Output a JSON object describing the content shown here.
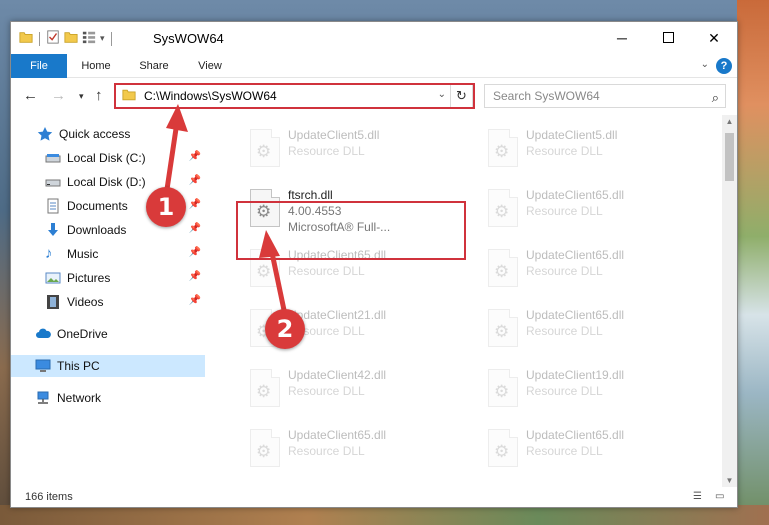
{
  "window": {
    "title": "SysWOW64"
  },
  "ribbon": {
    "tabs": [
      "File",
      "Home",
      "Share",
      "View"
    ],
    "help_label": "?"
  },
  "address": {
    "path": "C:\\Windows\\SysWOW64"
  },
  "search": {
    "placeholder": "Search SysWOW64"
  },
  "sidebar": {
    "items": [
      {
        "label": "Quick access",
        "icon": "star-icon"
      },
      {
        "label": "Local Disk (C:)",
        "icon": "drive-icon",
        "pinned": true
      },
      {
        "label": "Local Disk (D:)",
        "icon": "drive-icon",
        "pinned": true
      },
      {
        "label": "Documents",
        "icon": "document-icon",
        "pinned": true
      },
      {
        "label": "Downloads",
        "icon": "download-icon",
        "pinned": true
      },
      {
        "label": "Music",
        "icon": "music-icon",
        "pinned": true
      },
      {
        "label": "Pictures",
        "icon": "pictures-icon",
        "pinned": true
      },
      {
        "label": "Videos",
        "icon": "video-icon",
        "pinned": true
      },
      {
        "label": "OneDrive",
        "icon": "cloud-icon"
      },
      {
        "label": "This PC",
        "icon": "computer-icon",
        "selected": true
      },
      {
        "label": "Network",
        "icon": "network-icon"
      }
    ]
  },
  "files": {
    "left": [
      {
        "name": "UpdateClient5.dll",
        "sub1": "Resource DLL",
        "sub2": ""
      },
      {
        "name": "ftsrch.dll",
        "sub1": "4.00.4553",
        "sub2": "MicrosoftA® Full-...",
        "highlight": true
      },
      {
        "name": "UpdateClient65.dll",
        "sub1": "Resource DLL",
        "sub2": ""
      },
      {
        "name": "UpdateClient21.dll",
        "sub1": "Resource DLL",
        "sub2": ""
      },
      {
        "name": "UpdateClient42.dll",
        "sub1": "Resource DLL",
        "sub2": ""
      },
      {
        "name": "UpdateClient65.dll",
        "sub1": "Resource DLL",
        "sub2": ""
      }
    ],
    "right": [
      {
        "name": "UpdateClient5.dll",
        "sub1": "Resource DLL",
        "sub2": ""
      },
      {
        "name": "UpdateClient65.dll",
        "sub1": "Resource DLL",
        "sub2": ""
      },
      {
        "name": "UpdateClient65.dll",
        "sub1": "Resource DLL",
        "sub2": ""
      },
      {
        "name": "UpdateClient65.dll",
        "sub1": "Resource DLL",
        "sub2": ""
      },
      {
        "name": "UpdateClient19.dll",
        "sub1": "Resource DLL",
        "sub2": ""
      },
      {
        "name": "UpdateClient65.dll",
        "sub1": "Resource DLL",
        "sub2": ""
      }
    ]
  },
  "status": {
    "count": "166 items"
  },
  "callouts": [
    "1",
    "2"
  ],
  "colors": {
    "accent": "#1979ca",
    "highlight_red": "#d0323c",
    "callout_red": "#d93a3a",
    "selected_bg": "#cce8ff"
  }
}
